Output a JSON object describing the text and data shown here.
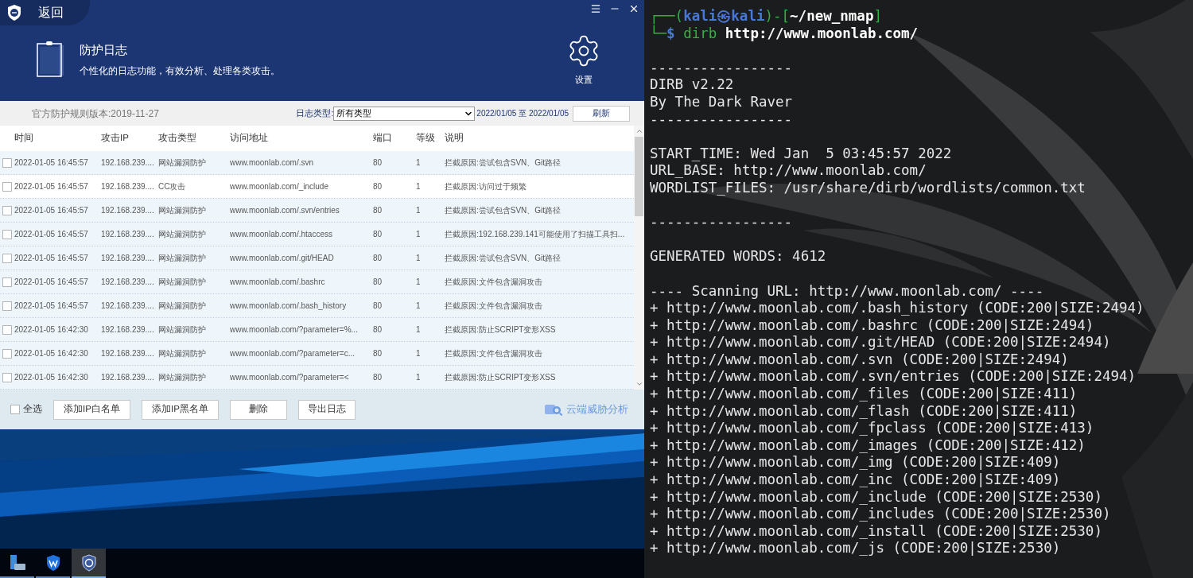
{
  "app": {
    "back": "返回",
    "title": "防护日志",
    "subtitle": "个性化的日志功能，有效分析、处理各类攻击。",
    "settings": "设置",
    "toolbar": {
      "rules_version": "官方防护规则版本:2019-11-27",
      "type_label": "日志类型:",
      "type_value": "所有类型",
      "date_range": "2022/01/05 至 2022/01/05",
      "refresh": "刷新"
    },
    "table": {
      "columns": [
        "时间",
        "攻击IP",
        "攻击类型",
        "访问地址",
        "端口",
        "等级",
        "说明"
      ],
      "rows": [
        {
          "checked": false,
          "selected": false,
          "cells": [
            "2022-01-05 16:45:57",
            "192.168.239....",
            "网站漏洞防护",
            "www.moonlab.com/.svn",
            "80",
            "1",
            "拦截原因:尝试包含SVN、Git路径"
          ]
        },
        {
          "checked": false,
          "selected": true,
          "cells": [
            "2022-01-05 16:45:57",
            "192.168.239....",
            "CC攻击",
            "www.moonlab.com/_include",
            "80",
            "1",
            "拦截原因:访问过于频繁"
          ]
        },
        {
          "checked": false,
          "selected": false,
          "cells": [
            "2022-01-05 16:45:57",
            "192.168.239....",
            "网站漏洞防护",
            "www.moonlab.com/.svn/entries",
            "80",
            "1",
            "拦截原因:尝试包含SVN、Git路径"
          ]
        },
        {
          "checked": false,
          "selected": false,
          "cells": [
            "2022-01-05 16:45:57",
            "192.168.239....",
            "网站漏洞防护",
            "www.moonlab.com/.htaccess",
            "80",
            "1",
            "拦截原因:192.168.239.141可能使用了扫描工具扫..."
          ]
        },
        {
          "checked": false,
          "selected": false,
          "cells": [
            "2022-01-05 16:45:57",
            "192.168.239....",
            "网站漏洞防护",
            "www.moonlab.com/.git/HEAD",
            "80",
            "1",
            "拦截原因:尝试包含SVN、Git路径"
          ]
        },
        {
          "checked": false,
          "selected": false,
          "cells": [
            "2022-01-05 16:45:57",
            "192.168.239....",
            "网站漏洞防护",
            "www.moonlab.com/.bashrc",
            "80",
            "1",
            "拦截原因:文件包含漏洞攻击"
          ]
        },
        {
          "checked": false,
          "selected": false,
          "cells": [
            "2022-01-05 16:45:57",
            "192.168.239....",
            "网站漏洞防护",
            "www.moonlab.com/.bash_history",
            "80",
            "1",
            "拦截原因:文件包含漏洞攻击"
          ]
        },
        {
          "checked": false,
          "selected": false,
          "cells": [
            "2022-01-05 16:42:30",
            "192.168.239....",
            "网站漏洞防护",
            "www.moonlab.com/?parameter=%...",
            "80",
            "1",
            "拦截原因:防止SCRIPT变形XSS"
          ]
        },
        {
          "checked": false,
          "selected": false,
          "cells": [
            "2022-01-05 16:42:30",
            "192.168.239....",
            "网站漏洞防护",
            "www.moonlab.com/?parameter=c...",
            "80",
            "1",
            "拦截原因:文件包含漏洞攻击"
          ]
        },
        {
          "checked": false,
          "selected": false,
          "cells": [
            "2022-01-05 16:42:30",
            "192.168.239....",
            "网站漏洞防护",
            "www.moonlab.com/?parameter=<",
            "80",
            "1",
            "拦截原因:防止SCRIPT变形XSS"
          ]
        }
      ]
    },
    "footer": {
      "select_all": {
        "label": "全选",
        "checked": false
      },
      "buttons": [
        "添加IP白名单",
        "添加IP黑名单",
        "删除",
        "导出日志"
      ],
      "cloud_link": "云端威胁分析"
    }
  },
  "taskbar": [
    {
      "selected": false
    },
    {
      "selected": false
    },
    {
      "selected": true
    }
  ],
  "terminal": {
    "prompt": [
      {
        "kind": "frame",
        "text": "┌──("
      },
      {
        "kind": "user",
        "text": "kali"
      },
      {
        "kind": "user",
        "text": "㉿"
      },
      {
        "kind": "user",
        "text": "kali"
      },
      {
        "kind": "frame",
        "text": ")-["
      },
      {
        "kind": "path",
        "text": "~/new_nmap"
      },
      {
        "kind": "frame",
        "text": "]"
      }
    ],
    "command_line": [
      {
        "kind": "frame",
        "text": "└─"
      },
      {
        "kind": "user",
        "text": "$"
      },
      {
        "kind": "command",
        "text": "dirb"
      },
      {
        "kind": "path",
        "text": "http://www.moonlab.com/"
      }
    ],
    "blocks": [
      [
        "-----------------",
        "DIRB v2.22",
        "By The Dark Raver",
        "-----------------"
      ],
      [
        "START_TIME: Wed Jan  5 03:45:57 2022",
        "URL_BASE: http://www.moonlab.com/",
        "WORDLIST_FILES: /usr/share/dirb/wordlists/common.txt"
      ],
      [
        "-----------------"
      ],
      [
        "GENERATED WORDS: 4612"
      ],
      [
        "---- Scanning URL: http://www.moonlab.com/ ----",
        "+ http://www.moonlab.com/.bash_history (CODE:200|SIZE:2494)",
        "+ http://www.moonlab.com/.bashrc (CODE:200|SIZE:2494)",
        "+ http://www.moonlab.com/.git/HEAD (CODE:200|SIZE:2494)",
        "+ http://www.moonlab.com/.svn (CODE:200|SIZE:2494)",
        "+ http://www.moonlab.com/.svn/entries (CODE:200|SIZE:2494)",
        "+ http://www.moonlab.com/_files (CODE:200|SIZE:411)",
        "+ http://www.moonlab.com/_flash (CODE:200|SIZE:411)",
        "+ http://www.moonlab.com/_fpclass (CODE:200|SIZE:413)",
        "+ http://www.moonlab.com/_images (CODE:200|SIZE:412)",
        "+ http://www.moonlab.com/_img (CODE:200|SIZE:409)",
        "+ http://www.moonlab.com/_inc (CODE:200|SIZE:409)",
        "+ http://www.moonlab.com/_include (CODE:200|SIZE:2530)",
        "+ http://www.moonlab.com/_includes (CODE:200|SIZE:2530)",
        "+ http://www.moonlab.com/_install (CODE:200|SIZE:2530)",
        "+ http://www.moonlab.com/_js (CODE:200|SIZE:2530)"
      ]
    ]
  }
}
